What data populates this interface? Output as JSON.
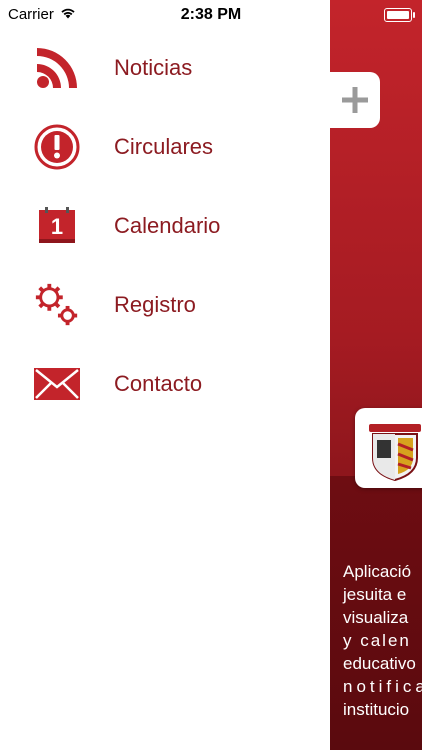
{
  "status_bar": {
    "carrier": "Carrier",
    "time": "2:38 PM"
  },
  "menu": {
    "items": [
      {
        "label": "Noticias",
        "icon": "rss-icon"
      },
      {
        "label": "Circulares",
        "icon": "alert-icon"
      },
      {
        "label": "Calendario",
        "icon": "calendar-icon",
        "calendar_day": "1"
      },
      {
        "label": "Registro",
        "icon": "gears-icon"
      },
      {
        "label": "Contacto",
        "icon": "envelope-icon"
      }
    ]
  },
  "main": {
    "description_lines": [
      "Aplicació",
      "jesuita e",
      "visualiza",
      "y calen",
      "educativo",
      "notifica",
      "institucio"
    ]
  },
  "colors": {
    "accent": "#c3242b",
    "menu_text": "#8c1b21",
    "panel_dark": "#5a0a0e"
  }
}
